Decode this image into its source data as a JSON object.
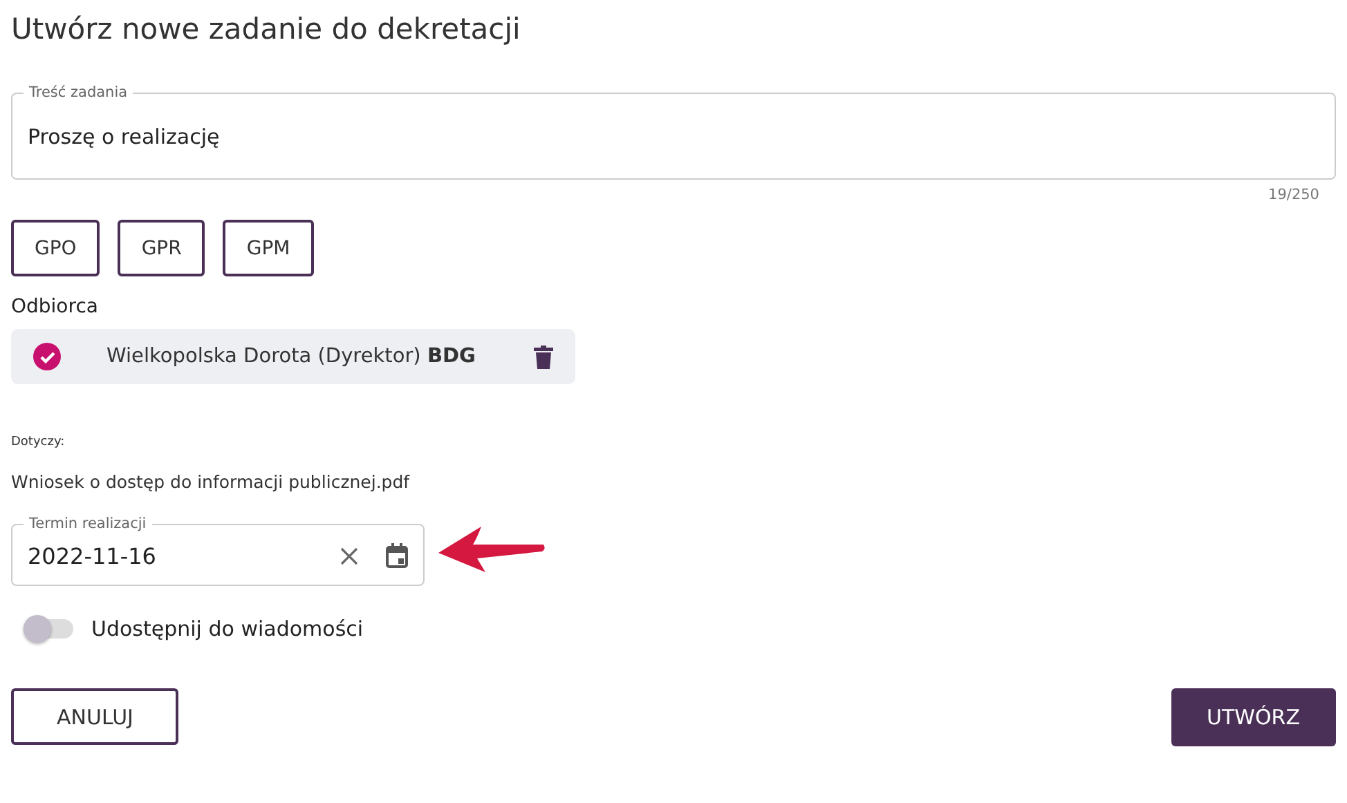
{
  "title": "Utwórz nowe zadanie do dekretacji",
  "task_field": {
    "label": "Treść zadania",
    "value": "Proszę o realizację",
    "counter": "19/250"
  },
  "group_buttons": [
    "GPO",
    "GPR",
    "GPM"
  ],
  "recipient_label": "Odbiorca",
  "recipients": [
    {
      "text": "Wielkopolska Dorota (Dyrektor) **BDG**",
      "checked": true
    }
  ],
  "concerns": {
    "label": "Dotyczy:",
    "file": "Wniosek o dostęp do informacji publicznej.pdf"
  },
  "date_field": {
    "label": "Termin realizacji",
    "value": "2022-11-16"
  },
  "share_toggle": {
    "label": "Udostępnij do wiadomości",
    "on": false
  },
  "buttons": {
    "cancel": "ANULUJ",
    "create": "UTWÓRZ"
  }
}
